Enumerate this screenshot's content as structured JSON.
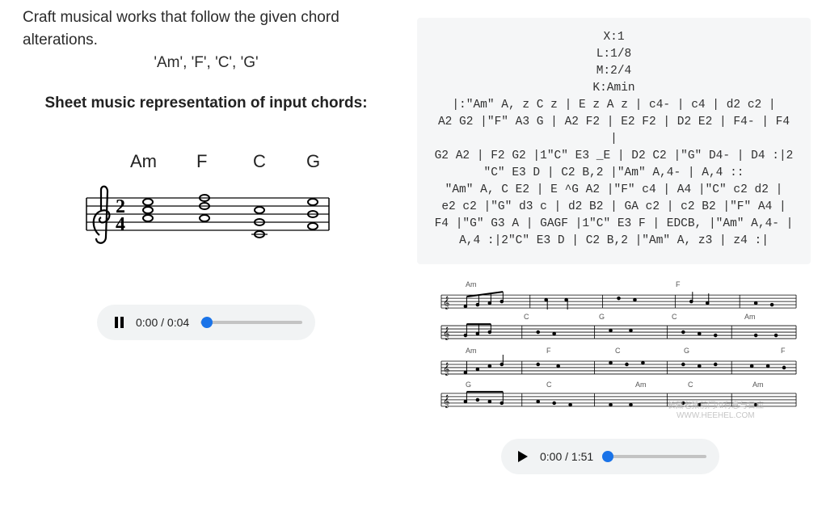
{
  "prompt": "Craft musical works that follow the given chord alterations.",
  "chords_input": "'Am', 'F', 'C', 'G'",
  "subtitle": "Sheet music representation of input chords:",
  "input_chords": [
    "Am",
    "F",
    "C",
    "G"
  ],
  "audio_left": {
    "state": "playing",
    "time": "0:00 / 0:04"
  },
  "audio_right": {
    "state": "paused",
    "time": "0:00 / 1:51"
  },
  "abc_text": "X:1\nL:1/8\nM:2/4\nK:Amin\n|:\"Am\" A, z C z | E z A z | c4- | c4 | d2 c2 |\nA2 G2 |\"F\" A3 G | A2 F2 | E2 F2 | D2 E2 | F4- | F4 |\nG2 A2 | F2 G2 |1\"C\" E3 _E | D2 C2 |\"G\" D4- | D4 :|2\n\"C\" E3 D | C2 B,2 |\"Am\" A,4- | A,4 ::\n\"Am\" A, C E2 | E ^G A2 |\"F\" c4 | A4 |\"C\" c2 d2 |\ne2 c2 |\"G\" d3 c | d2 B2 | GA c2 | c2 B2 |\"F\" A4 |\nF4 |\"G\" G3 A | GAGF |1\"C\" E3 F | EDCB, |\"Am\" A,4- |\nA,4 :|2\"C\" E3 D | C2 B,2 |\"Am\" A, z3 | z4 :|",
  "output_chord_rows": [
    [
      "Am",
      "",
      "",
      "F",
      ""
    ],
    [
      "",
      "C",
      "G",
      "C",
      "Am"
    ],
    [
      "Am",
      "F",
      "C",
      "G",
      "F"
    ],
    [
      "G",
      "C",
      "Am",
      "C",
      "Am"
    ]
  ],
  "watermark": {
    "line1": "长藏老猿前门AI有息与日应",
    "line2": "WWW.HEEHEL.COM"
  }
}
